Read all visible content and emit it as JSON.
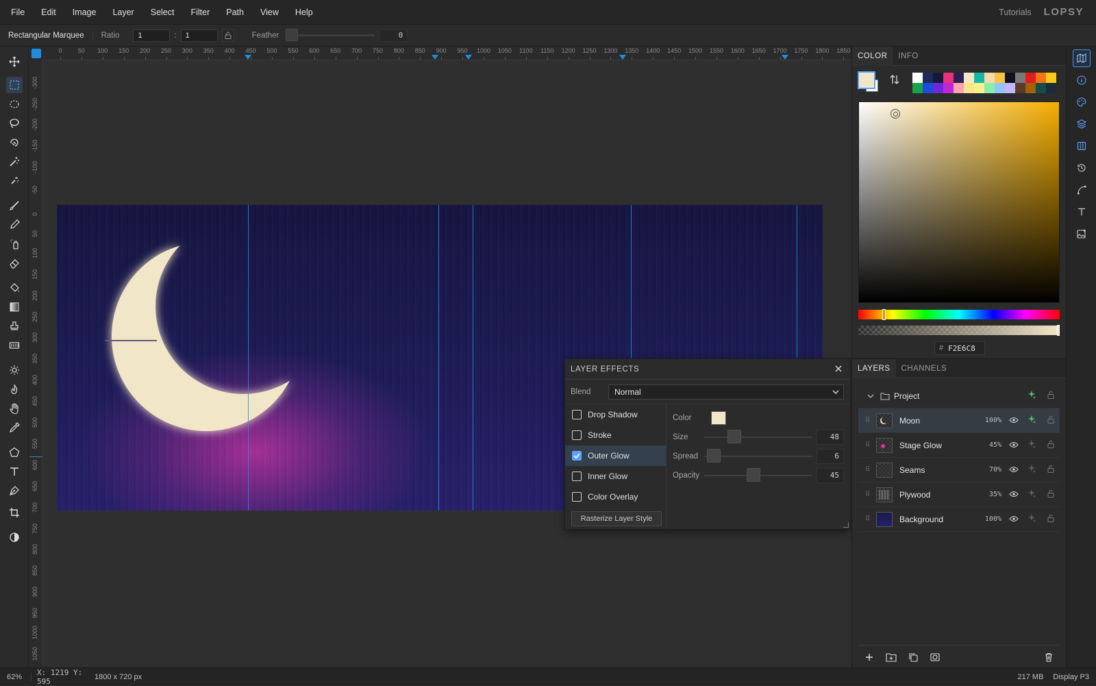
{
  "menubar": {
    "items": [
      "File",
      "Edit",
      "Image",
      "Layer",
      "Select",
      "Filter",
      "Path",
      "View",
      "Help"
    ],
    "tutorials": "Tutorials",
    "logo": "LOPSY"
  },
  "options": {
    "tool_name": "Rectangular Marquee",
    "ratio_label": "Ratio",
    "ratio_w": "1",
    "ratio_sep": ":",
    "ratio_h": "1",
    "feather_label": "Feather",
    "feather_value": "0"
  },
  "tools": [
    "move-icon",
    "rect-marquee-icon",
    "ellipse-marquee-icon",
    "lasso-icon",
    "magnetic-lasso-icon",
    "magic-wand-icon",
    "quick-select-icon",
    "brush-icon",
    "pencil-icon",
    "spray-icon",
    "eraser-icon",
    "paint-bucket-icon",
    "gradient-icon",
    "stamp-icon",
    "pattern-icon",
    "dodge-icon",
    "burn-icon",
    "hand-icon",
    "eyedropper-icon",
    "polygon-icon",
    "text-icon",
    "pen-icon",
    "crop-icon",
    "mask-toggle-icon"
  ],
  "ruler": {
    "top": [
      "0",
      "50",
      "100",
      "150",
      "200",
      "250",
      "300",
      "350",
      "400",
      "450",
      "500",
      "550",
      "600",
      "650",
      "700",
      "750",
      "800",
      "850",
      "900",
      "950",
      "1000",
      "1050",
      "1100",
      "1150",
      "1200",
      "1250",
      "1300",
      "1350",
      "1400",
      "1450",
      "1500",
      "1550",
      "1600",
      "1650",
      "1700",
      "1750",
      "1800",
      "1850"
    ],
    "left": [
      "-300",
      "-250",
      "-200",
      "-150",
      "-100",
      "-50",
      "0",
      "50",
      "100",
      "150",
      "200",
      "250",
      "300",
      "350",
      "400",
      "450",
      "500",
      "550",
      "600",
      "650",
      "700",
      "750",
      "800",
      "850",
      "900",
      "950",
      "1000",
      "1050"
    ]
  },
  "color_panel": {
    "tabs": [
      "COLOR",
      "INFO"
    ],
    "foreground": "#f2e6c8",
    "background": "#ffffff",
    "hex": "F2E6C8",
    "palette": [
      "#ffffff",
      "#1e2a5a",
      "#121a3a",
      "#e8327a",
      "#2b1f55",
      "#f3e8c6",
      "#14b8a6",
      "#f5d9a8",
      "#f4c542",
      "#10131f",
      "#7a7a7a",
      "#e11d1d",
      "#f97316",
      "#facc15",
      "#16a34a",
      "#1d4ed8",
      "#6d28d9",
      "#c026d3",
      "#fda4af",
      "#fde68a",
      "#fef08a",
      "#86efac",
      "#93c5fd",
      "#c4b5fd",
      "#5b3a29",
      "#a16207",
      "#134e4a",
      "#1e293b"
    ]
  },
  "layers_panel": {
    "tabs": [
      "LAYERS",
      "CHANNELS"
    ],
    "group": "Project",
    "layers": [
      {
        "name": "Moon",
        "opacity": "100%"
      },
      {
        "name": "Stage Glow",
        "opacity": "45%"
      },
      {
        "name": "Seams",
        "opacity": "70%"
      },
      {
        "name": "Plywood",
        "opacity": "35%"
      },
      {
        "name": "Background",
        "opacity": "100%"
      }
    ]
  },
  "layer_effects": {
    "title": "LAYER EFFECTS",
    "blend_label": "Blend",
    "blend_value": "Normal",
    "effects": [
      {
        "label": "Drop Shadow",
        "checked": false
      },
      {
        "label": "Stroke",
        "checked": false
      },
      {
        "label": "Outer Glow",
        "checked": true
      },
      {
        "label": "Inner Glow",
        "checked": false
      },
      {
        "label": "Color Overlay",
        "checked": false
      }
    ],
    "rasterize": "Rasterize Layer Style",
    "settings": {
      "color_label": "Color",
      "color": "#f2e6c8",
      "size_label": "Size",
      "size": "48",
      "spread_label": "Spread",
      "spread": "6",
      "opacity_label": "Opacity",
      "opacity": "45"
    }
  },
  "status": {
    "zoom": "62%",
    "xy": "X: 1219 Y: 595",
    "dims": "1800 x 720 px",
    "memory": "217 MB",
    "profile": "Display P3"
  }
}
